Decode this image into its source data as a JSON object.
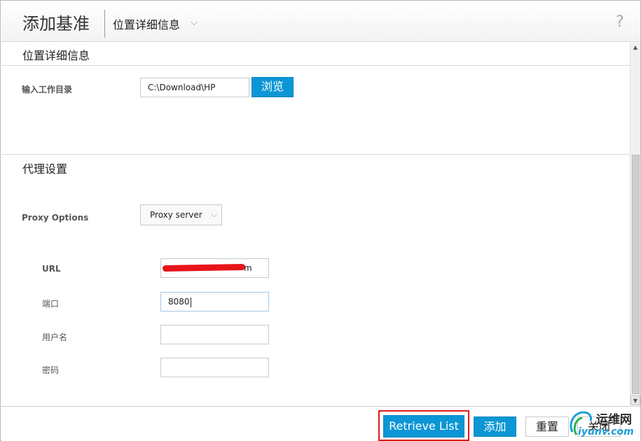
{
  "header": {
    "title": "添加基准",
    "breadcrumb": "位置详细信息",
    "help_glyph": "?"
  },
  "location_section": {
    "title": "位置详细信息",
    "work_dir_label": "输入工作目录",
    "work_dir_value": "C:\\Download\\HP",
    "browse_label": "浏览"
  },
  "proxy_section": {
    "title": "代理设置",
    "proxy_options_label": "Proxy Options",
    "proxy_options_selected": "Proxy server",
    "url_label": "URL",
    "url_visible_end": "m",
    "port_label": "端口",
    "port_value": "8080",
    "username_label": "用户名",
    "username_value": "",
    "password_label": "密码",
    "password_value": ""
  },
  "footer": {
    "retrieve_label": "Retrieve List",
    "add_label": "添加",
    "reset_label": "重置",
    "close_label": "关闭"
  },
  "watermark": {
    "cn_text": "运维网",
    "url_text": "iyunv.com"
  },
  "colors": {
    "accent_blue": "#0c96d5",
    "highlight_red": "#e11b1b",
    "redaction_red": "#e8141b"
  }
}
